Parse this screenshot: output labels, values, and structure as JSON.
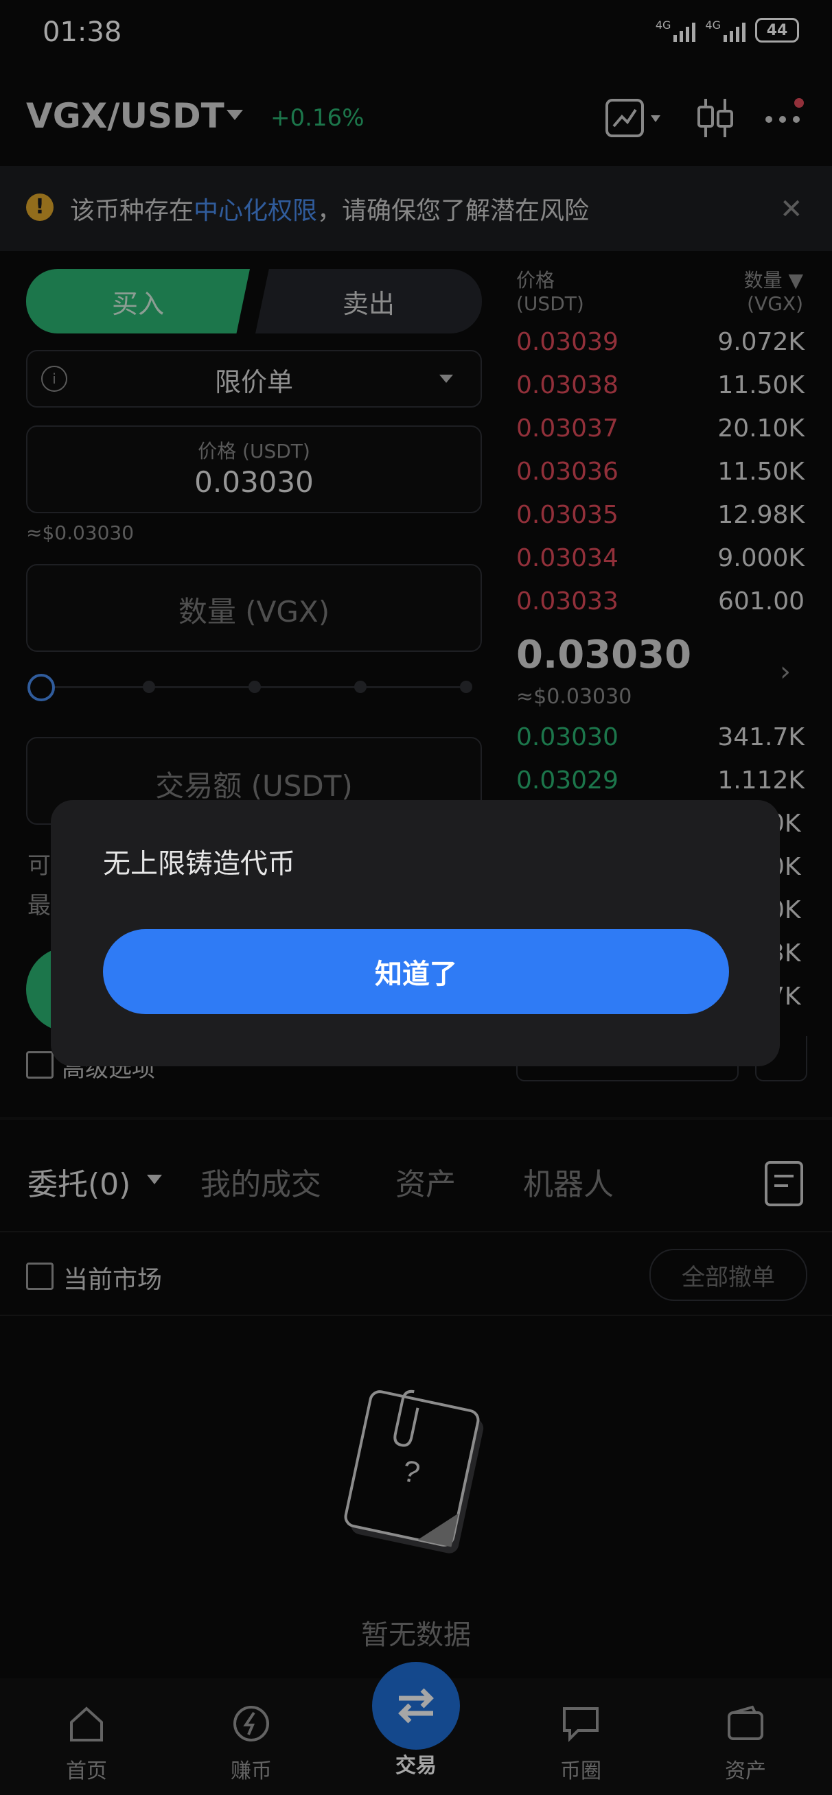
{
  "status_bar": {
    "time": "01:38",
    "network1": "4G",
    "network2": "4G",
    "battery": "44"
  },
  "header": {
    "pair": "VGX/USDT",
    "change": "+0.16%",
    "icons": [
      "chart-icon",
      "candlestick-icon",
      "more-icon"
    ],
    "colors": {
      "positive": "#2bb673",
      "negative": "#e04a5a",
      "accent": "#2f7bf5"
    }
  },
  "warning": {
    "prefix": "该币种存在",
    "link": "中心化权限",
    "suffix": "，请确保您了解潜在风险"
  },
  "trade_form": {
    "buy_label": "买入",
    "sell_label": "卖出",
    "order_type": "限价单",
    "price_label": "价格 (USDT)",
    "price_value": "0.03030",
    "price_approx": "≈$0.03030",
    "qty_placeholder": "数量 (VGX)",
    "amount_placeholder": "交易额 (USDT)",
    "avail_line1": "可",
    "avail_line2": "最",
    "advanced_label": "高级选项"
  },
  "order_book": {
    "price_header_1": "价格",
    "price_header_2": "(USDT)",
    "qty_header_1": "数量 ▼",
    "qty_header_2": "(VGX)",
    "asks": [
      {
        "price": "0.03039",
        "qty": "9.072K"
      },
      {
        "price": "0.03038",
        "qty": "11.50K"
      },
      {
        "price": "0.03037",
        "qty": "20.10K"
      },
      {
        "price": "0.03036",
        "qty": "11.50K"
      },
      {
        "price": "0.03035",
        "qty": "12.98K"
      },
      {
        "price": "0.03034",
        "qty": "9.000K"
      },
      {
        "price": "0.03033",
        "qty": "601.00"
      }
    ],
    "last_price": "0.03030",
    "last_usd": "≈$0.03030",
    "bids": [
      {
        "price": "0.03030",
        "qty": "341.7K"
      },
      {
        "price": "0.03029",
        "qty": "1.112K"
      }
    ],
    "partial_bids": [
      "0K",
      "0K",
      "0K",
      "3K",
      "7K"
    ]
  },
  "tabs": {
    "orders": "委托(0)",
    "trades": "我的成交",
    "assets": "资产",
    "bots": "机器人"
  },
  "filter": {
    "current_market": "当前市场",
    "cancel_all": "全部撤单"
  },
  "empty_state": {
    "label": "暂无数据"
  },
  "bottom_nav": {
    "home": "首页",
    "earn": "赚币",
    "trade": "交易",
    "community": "币圈",
    "assets": "资产"
  },
  "dialog": {
    "title": "无上限铸造代币",
    "confirm": "知道了"
  }
}
